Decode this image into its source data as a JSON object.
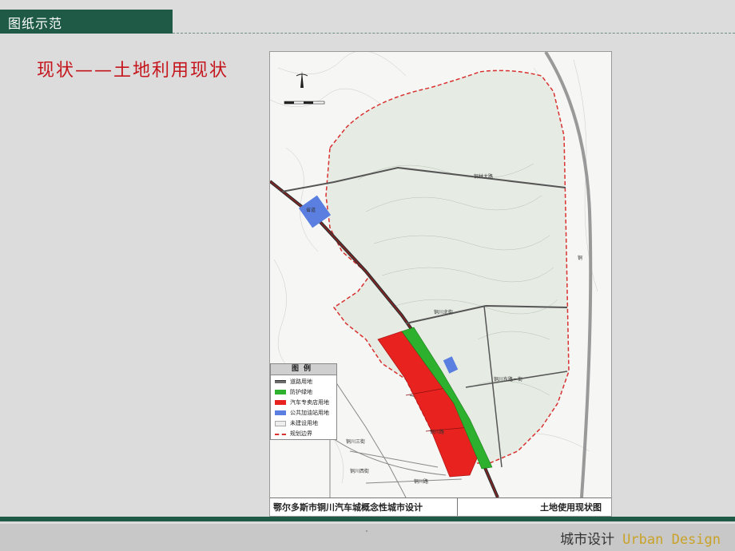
{
  "header": {
    "section_label": "图纸示范"
  },
  "slide": {
    "title": "现状——土地利用现状"
  },
  "map": {
    "footer_left": "鄂尔多斯市铜川汽车城概念性城市设计",
    "footer_right": "土地使用现状图",
    "road_labels": {
      "north_road": "铜林大路",
      "east_road": "铜",
      "lower_road_1": "铜川北街",
      "lower_road_2": "铜川东路一街",
      "diag_road": "省道",
      "south_road": "铜川路",
      "south_west": "铜川西街",
      "sw_street": "铜川三街",
      "inner_road": "铜川路"
    },
    "legend": {
      "title": "图例",
      "items": [
        {
          "label": "道路用地",
          "swatch": "road"
        },
        {
          "label": "防护绿地",
          "swatch": "green"
        },
        {
          "label": "汽车专卖店用地",
          "swatch": "red"
        },
        {
          "label": "公共加油站用地",
          "swatch": "blue"
        },
        {
          "label": "未建设用地",
          "swatch": "empty"
        },
        {
          "label": "规划边界",
          "swatch": "dash"
        }
      ]
    },
    "colors": {
      "red_zone": "#e8231f",
      "green_buffer": "#2db02d",
      "blue_station": "#5b7fe0",
      "boundary": "#d93030",
      "unbuilt": "#e6ece4"
    }
  },
  "footer": {
    "cn": "城市设计",
    "en": "Urban Design"
  }
}
